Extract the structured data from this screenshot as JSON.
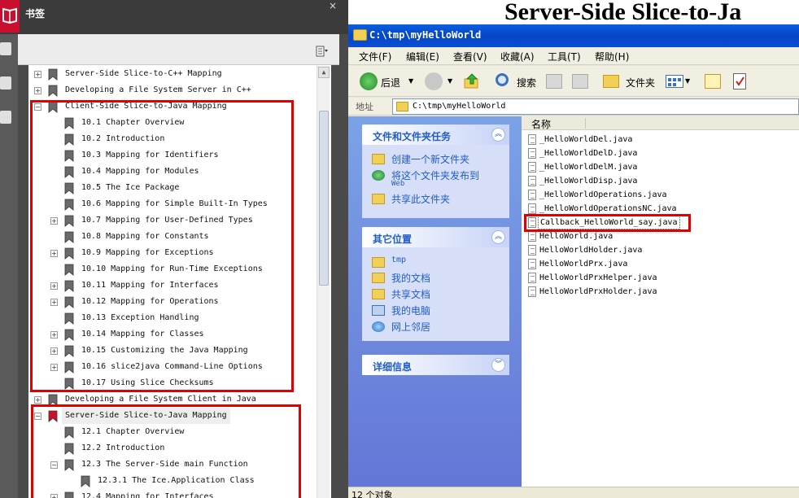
{
  "bookmarks_panel": {
    "title": "书签",
    "close_label": "×",
    "items": [
      {
        "label": "Server-Side Slice-to-C++ Mapping",
        "expander": "+"
      },
      {
        "label": "Developing a File System Server in C++",
        "expander": "+"
      },
      {
        "label": "Client-Side Slice-to-Java Mapping",
        "expander": "−"
      },
      {
        "label": "10.1 Chapter Overview",
        "expander": ""
      },
      {
        "label": "10.2 Introduction",
        "expander": ""
      },
      {
        "label": "10.3 Mapping for Identifiers",
        "expander": ""
      },
      {
        "label": "10.4 Mapping for Modules",
        "expander": ""
      },
      {
        "label": "10.5 The Ice Package",
        "expander": ""
      },
      {
        "label": "10.6 Mapping for Simple Built-In Types",
        "expander": ""
      },
      {
        "label": "10.7 Mapping for User-Defined Types",
        "expander": "+"
      },
      {
        "label": "10.8 Mapping for Constants",
        "expander": ""
      },
      {
        "label": "10.9 Mapping for Exceptions",
        "expander": "+"
      },
      {
        "label": "10.10 Mapping for Run-Time Exceptions",
        "expander": ""
      },
      {
        "label": "10.11 Mapping for Interfaces",
        "expander": "+"
      },
      {
        "label": "10.12 Mapping for Operations",
        "expander": "+"
      },
      {
        "label": "10.13 Exception Handling",
        "expander": ""
      },
      {
        "label": "10.14 Mapping for Classes",
        "expander": "+"
      },
      {
        "label": "10.15 Customizing the Java Mapping",
        "expander": "+"
      },
      {
        "label": "10.16 slice2java Command-Line Options",
        "expander": "+"
      },
      {
        "label": "10.17 Using Slice Checksums",
        "expander": ""
      },
      {
        "label": "Developing a File System Client in Java",
        "expander": "+"
      },
      {
        "label": "Server-Side Slice-to-Java Mapping",
        "expander": "−"
      },
      {
        "label": "12.1 Chapter Overview",
        "expander": ""
      },
      {
        "label": "12.2 Introduction",
        "expander": ""
      },
      {
        "label": "12.3 The Server-Side main Function",
        "expander": "−"
      },
      {
        "label": "12.3.1 The Ice.Application Class",
        "expander": ""
      },
      {
        "label": "12.4 Mapping for Interfaces",
        "expander": "+"
      }
    ]
  },
  "explorer": {
    "background_heading": "Server-Side Slice-to-Ja",
    "title": "C:\\tmp\\myHelloWorld",
    "menu": [
      "文件(F)",
      "编辑(E)",
      "查看(V)",
      "收藏(A)",
      "工具(T)",
      "帮助(H)"
    ],
    "toolbar": {
      "back": "后退",
      "search": "搜索",
      "folders": "文件夹"
    },
    "address": {
      "label": "地址",
      "value": "C:\\tmp\\myHelloWorld"
    },
    "tasks_panel": {
      "title": "文件和文件夹任务",
      "items": [
        {
          "label": "创建一个新文件夹",
          "label2": ""
        },
        {
          "label": "将这个文件夹发布到",
          "label2": "Web"
        },
        {
          "label": "共享此文件夹",
          "label2": ""
        }
      ]
    },
    "places_panel": {
      "title": "其它位置",
      "items": [
        "tmp",
        "我的文档",
        "共享文档",
        "我的电脑",
        "网上邻居"
      ]
    },
    "details_panel": {
      "title": "详细信息"
    },
    "column_name": "名称",
    "files": [
      "_HelloWorldDel.java",
      "_HelloWorldDelD.java",
      "_HelloWorldDelM.java",
      "_HelloWorldDisp.java",
      "_HelloWorldOperations.java",
      "_HelloWorldOperationsNC.java",
      "Callback_HelloWorld_say.java",
      "HelloWorld.java",
      "HelloWorldHolder.java",
      "HelloWorldPrx.java",
      "HelloWorldPrxHelper.java",
      "HelloWorldPrxHolder.java"
    ],
    "selected_file_index": 6,
    "status": "12 个对象"
  },
  "colors": {
    "highlight_box": "#e00000",
    "xp_title_blue": "#0645c8",
    "task_link": "#215dc6"
  }
}
